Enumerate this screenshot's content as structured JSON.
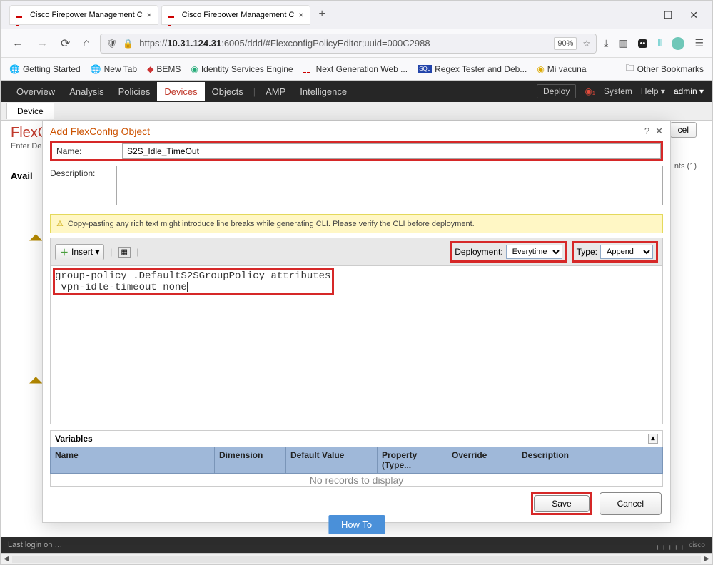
{
  "browser": {
    "tabs": [
      {
        "title": "Cisco Firepower Management C"
      },
      {
        "title": "Cisco Firepower Management C"
      }
    ],
    "url_prefix": "https://",
    "url_host": "10.31.124.31",
    "url_rest": ":6005/ddd/#FlexconfigPolicyEditor;uuid=000C2988",
    "zoom": "90%",
    "bookmarks": [
      "Getting Started",
      "New Tab",
      "BEMS",
      "Identity Services Engine",
      "Next Generation Web ...",
      "Regex Tester and Deb...",
      "Mi vacuna"
    ],
    "other_bookmarks": "Other Bookmarks"
  },
  "app_nav": {
    "items": [
      "Overview",
      "Analysis",
      "Policies",
      "Devices",
      "Objects",
      "AMP",
      "Intelligence"
    ],
    "active": "Devices",
    "deploy": "Deploy",
    "system": "System",
    "help": "Help ▾",
    "user": "admin ▾"
  },
  "sub_nav": {
    "tab": "Device"
  },
  "page": {
    "title": "FlexC",
    "sub": "Enter De",
    "cancel": "cel",
    "avail": "Avail",
    "nts": "nts (1)"
  },
  "modal": {
    "title": "Add FlexConfig Object",
    "name_label": "Name:",
    "name_value": "S2S_Idle_TimeOut",
    "desc_label": "Description:",
    "desc_value": "",
    "warning": "Copy-pasting any rich text might introduce line breaks while generating CLI. Please verify the CLI before deployment.",
    "insert": "Insert ▾",
    "deployment_label": "Deployment:",
    "deployment_value": "Everytime",
    "type_label": "Type:",
    "type_value": "Append",
    "code": "group-policy .DefaultS2SGroupPolicy attributes\n vpn-idle-timeout none",
    "variables_title": "Variables",
    "var_cols": {
      "name": "Name",
      "dim": "Dimension",
      "def": "Default Value",
      "prop": "Property (Type...",
      "over": "Override",
      "desc": "Description"
    },
    "no_records": "No records to display",
    "save": "Save",
    "cancel": "Cancel"
  },
  "howto": "How To",
  "status": "Last login on …",
  "brand": "cisco"
}
